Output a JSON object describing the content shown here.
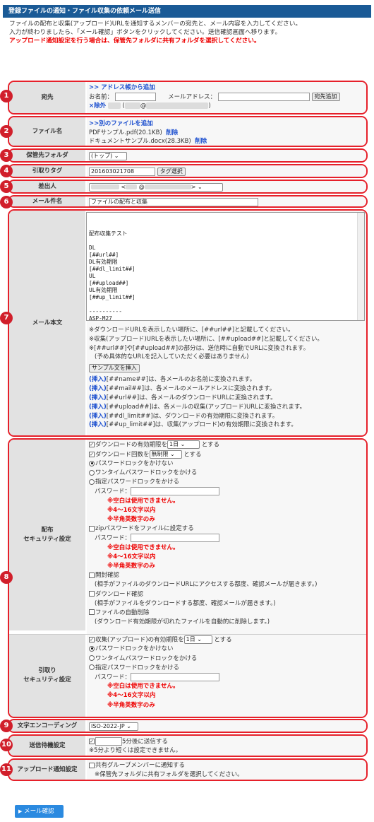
{
  "title": "登録ファイルの通知・ファイル収集の依頼メール送信",
  "intro": {
    "line1": "ファイルの配布と収集(アップロード)URLを通知するメンバーの宛先と、メール内容を入力してください。",
    "line2": "入力が終わりましたら、「メール確認」ボタンをクリックしてください。送信確認画面へ移ります。",
    "warning": "アップロード通知設定を行う場合は、保管先フォルダに共有フォルダを選択してください。"
  },
  "badges": [
    "1",
    "2",
    "3",
    "4",
    "5",
    "6",
    "7",
    "8",
    "9",
    "10",
    "11"
  ],
  "recipient": {
    "label": "宛先",
    "address_book_link": ">> アドレス帳から追加",
    "name_label": "お名前：",
    "email_label": "メールアドレス：",
    "add_button": "宛先追加",
    "remove_link": "×除外",
    "at": "@"
  },
  "filename": {
    "label": "ファイル名",
    "add_link": ">>別のファイルを追加",
    "files": [
      {
        "name": "PDFサンプル.pdf(20.1KB)",
        "delete": "削除"
      },
      {
        "name": "ドキュメントサンプル.docx(28.3KB)",
        "delete": "削除"
      }
    ]
  },
  "folder": {
    "label": "保管先フォルダ",
    "value": "(トップ)"
  },
  "tag": {
    "label": "引取りタグ",
    "value": "201603021708",
    "button": "タグ選択"
  },
  "sender": {
    "label": "差出人",
    "lt": "<",
    "at": "@",
    "gt": ">"
  },
  "subject": {
    "label": "メール件名",
    "value": "ファイルの配布と収集"
  },
  "body": {
    "label": "メール本文",
    "text": "\n配布収集テスト\n\nDL\n[##url##]\nDL有効期限\n[##dl_limit##]\nUL\n[##upload##]\nUL有効期限\n[##up_limit##]\n\n----------\nASP-M27",
    "note1": "※ダウンロードURLを表示したい場所に、[##url##]と記載してください。",
    "note2": "※収集(アップロード)URLを表示したい場所に、[##upload##]と記載してください。",
    "note3": "※[##url##]や[##upload##]の部分は、送信時に自動でURLに変換されます。",
    "note4": "(予め具体的なURLを記入していただく必要はありません)",
    "sample_button": "サンプル文を挿入",
    "inserts": [
      {
        "link": "(挿入)",
        "text": "[##name##]は、各メールのお名前に変換されます。"
      },
      {
        "link": "(挿入)",
        "text": "[##mail##]は、各メールのメールアドレスに変換されます。"
      },
      {
        "link": "(挿入)",
        "text": "[##url##]は、各メールのダウンロードURLに変換されます。"
      },
      {
        "link": "(挿入)",
        "text": "[##upload##]は、各メールの収集(アップロード)URLに変換されます。"
      },
      {
        "link": "(挿入)",
        "text": "[##dl_limit##]は、ダウンロードの有効期限に変換されます。"
      },
      {
        "link": "(挿入)",
        "text": "[##up_limit##]は、収集(アップロード)の有効期限に変換されます。"
      }
    ]
  },
  "dist_security": {
    "label_line1": "配布",
    "label_line2": "セキュリティ設定",
    "dl_limit_pre": "ダウンロードの有効期限を",
    "dl_limit_value": "1日",
    "dl_limit_post": "とする",
    "dl_count_pre": "ダウンロード回数を",
    "dl_count_value": "無制限",
    "dl_count_post": "とする",
    "opt_none": "パスワードロックをかけない",
    "opt_onetime": "ワンタイムパスワードロックをかける",
    "opt_fixed": "指定パスワードロックをかける",
    "password_label": "パスワード：",
    "rule1": "※空白は使用できません。",
    "rule2": "※4～16文字以内",
    "rule3": "※半角英数字のみ",
    "zip": "zipパスワードをファイルに設定する",
    "open_confirm": "開封確認",
    "open_confirm_note": "(相手がファイルのダウンロードURLにアクセスする都度、確認メールが届きます。)",
    "dl_confirm": "ダウンロード確認",
    "dl_confirm_note": "(相手がファイルをダウンロードする都度、確認メールが届きます。)",
    "auto_delete": "ファイルの自動削除",
    "auto_delete_note": "(ダウンロード有効期限が切れたファイルを自動的に削除します。)"
  },
  "collect_security": {
    "label_line1": "引取り",
    "label_line2": "セキュリティ設定",
    "limit_pre": "収集(アップロード)の有効期限を",
    "limit_value": "1日",
    "limit_post": "とする",
    "opt_none": "パスワードロックをかけない",
    "opt_onetime": "ワンタイムパスワードロックをかける",
    "opt_fixed": "指定パスワードロックをかける",
    "password_label": "パスワード：",
    "rule1": "※空白は使用できません。",
    "rule2": "※4～16文字以内",
    "rule3": "※半角英数字のみ"
  },
  "encoding": {
    "label": "文字エンコーディング",
    "value": "ISO-2022-JP"
  },
  "send_wait": {
    "label": "送信待機設定",
    "suffix": "5分後に送信する",
    "note": "※5分より短くは設定できません。"
  },
  "upload_notify": {
    "label": "アップロード通知設定",
    "option": "共有グループメンバーに通知する",
    "note": "※保管先フォルダに共有フォルダを選択してください。"
  },
  "confirm_button": "メール確認",
  "colors": {
    "title_bg": "#1a5a96",
    "badge": "#d11f2b",
    "border": "#e6202a",
    "link": "#1c4fcf",
    "button": "#2b8ae0"
  }
}
